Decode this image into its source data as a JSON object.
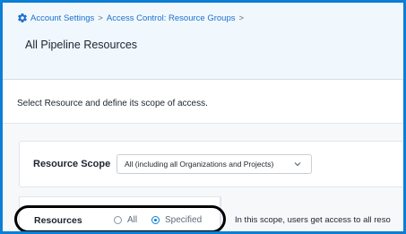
{
  "breadcrumb": {
    "icon": "gear-icon",
    "items": [
      "Account Settings",
      "Access Control: Resource Groups"
    ],
    "separator": ">"
  },
  "page": {
    "title": "All Pipeline Resources"
  },
  "instruction": "Select Resource and define its scope of access.",
  "resource_scope": {
    "label": "Resource Scope",
    "selected_value": "All (including all Organizations and Projects)"
  },
  "resources": {
    "label": "Resources",
    "options": [
      {
        "label": "All",
        "selected": false
      },
      {
        "label": "Specified",
        "selected": true
      }
    ],
    "description": "In this scope, users get access to all reso"
  },
  "colors": {
    "accent": "#0b7fd6",
    "header_bg": "#f0f8fd",
    "annotation": "#000000"
  }
}
